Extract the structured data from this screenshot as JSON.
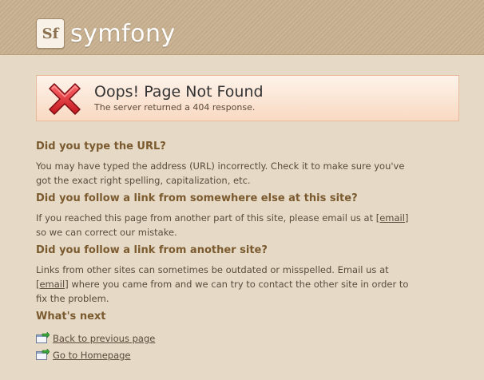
{
  "logo": {
    "badge": "Sf",
    "text": "symfony"
  },
  "notice": {
    "title": "Oops! Page Not Found",
    "subtitle": "The server returned a 404 response."
  },
  "sections": [
    {
      "heading": "Did you type the URL?",
      "body": "You may have typed the address (URL) incorrectly. Check it to make sure you've got the exact right spelling, capitalization, etc."
    },
    {
      "heading": "Did you follow a link from somewhere else at this site?",
      "body_before": "If you reached this page from another part of this site, please email us at",
      "link": "[email]",
      "body_after": "so we can correct our mistake."
    },
    {
      "heading": "Did you follow a link from another site?",
      "body_before": "Links from other sites can sometimes be outdated or misspelled. Email us at",
      "link": "[email]",
      "body_after": "where you came from and we can try to contact the other site in order to fix the problem."
    }
  ],
  "whats_next": {
    "heading": "What's next",
    "links": [
      {
        "label": "Back to previous page",
        "icon": "arrow-page-icon"
      },
      {
        "label": "Go to Homepage",
        "icon": "arrow-page-icon"
      }
    ]
  },
  "colors": {
    "background": "#e6dac7",
    "heading": "#7a5a2e",
    "notice_border": "#e8b99a",
    "error_red": "#d4232b"
  }
}
